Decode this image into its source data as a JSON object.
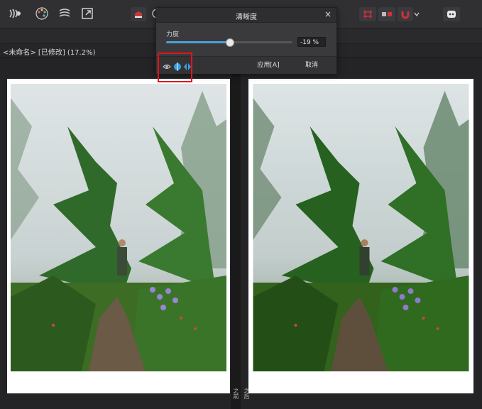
{
  "toolbar": {
    "left_icons": [
      "hdr-waves-icon",
      "palette-icon",
      "distort-icon",
      "export-icon",
      "fill-color-icon",
      "partial-circle-icon"
    ],
    "right_icons": [
      "grid-red-icon",
      "split-view-icon",
      "magnet-icon",
      "chevron-down-icon",
      "assistant-robot-icon"
    ]
  },
  "document": {
    "title": "<未命名> [已修改] (17.2%)"
  },
  "dialog": {
    "title": "清晰度",
    "close": "×",
    "strength_label": "力度",
    "strength_value_text": "-19 %",
    "strength_fraction": 0.5,
    "apply_label": "应用[A]",
    "cancel_label": "取消",
    "footer_icons": [
      "eye-icon",
      "split-compare-icon",
      "mirror-compare-icon"
    ]
  },
  "split_labels": {
    "left": "之前",
    "right": "之后"
  },
  "colors": {
    "accent": "#4b9fdb",
    "highlight_box": "#e3141c",
    "background": "#242426"
  }
}
